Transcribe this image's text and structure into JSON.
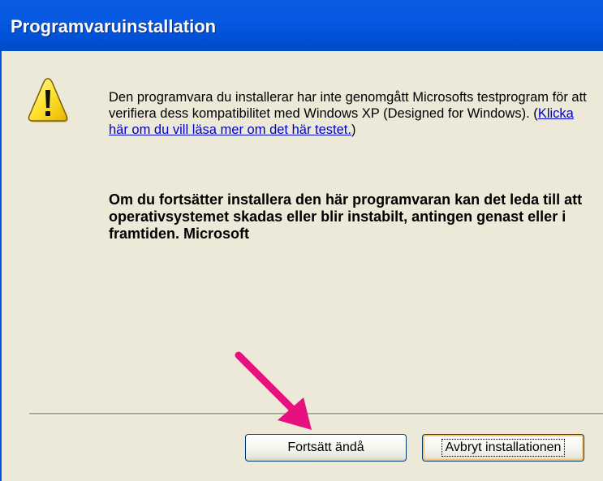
{
  "window": {
    "title": "Programvaruinstallation"
  },
  "icon": {
    "name": "warning-icon"
  },
  "message": {
    "text_before_link": "Den programvara du installerar har inte genomgått Microsofts testprogram för att verifiera dess kompatibilitet med Windows XP (Designed for Windows). (",
    "link_text": "Klicka här om du vill läsa mer om det här testet.",
    "text_after_link": ")",
    "warning_text": "Om du fortsätter installera den här programvaran kan det leda till att operativsystemet skadas eller blir instabilt, antingen genast eller i framtiden. Microsoft"
  },
  "buttons": {
    "continue_label": "Fortsätt ändå",
    "cancel_label": "Avbryt installationen"
  },
  "colors": {
    "titlebar": "#0055E5",
    "dialog_bg": "#ECE9D8",
    "link": "#0000CC",
    "annotation_arrow": "#E6117F"
  }
}
